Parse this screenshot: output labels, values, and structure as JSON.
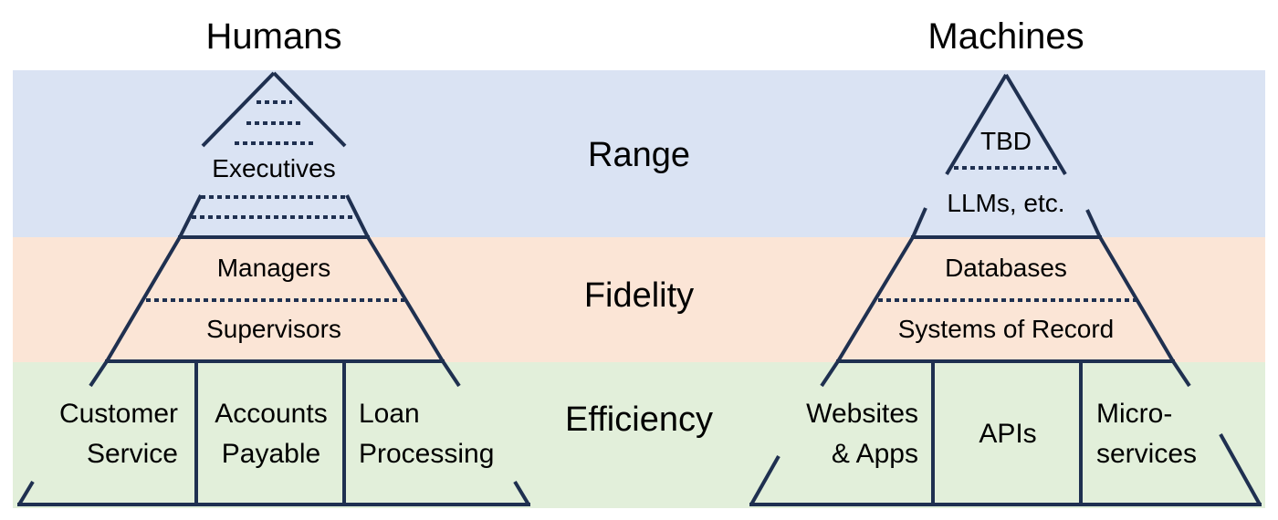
{
  "titles": {
    "left": "Humans",
    "right": "Machines"
  },
  "bands": [
    {
      "label": "Range",
      "color": "#dae3f3"
    },
    {
      "label": "Fidelity",
      "color": "#fbe5d6"
    },
    {
      "label": "Efficiency",
      "color": "#e2efda"
    }
  ],
  "line_color": "#1f3050",
  "humans": {
    "top_label": "Executives",
    "middle_labels": [
      "Managers",
      "Supervisors"
    ],
    "base_cells": [
      {
        "line1": "Customer",
        "line2": "Service"
      },
      {
        "line1": "Accounts",
        "line2": "Payable"
      },
      {
        "line1": "Loan",
        "line2": "Processing"
      }
    ]
  },
  "machines": {
    "apex_label": "TBD",
    "top_label": "LLMs, etc.",
    "middle_labels": [
      "Databases",
      "Systems of Record"
    ],
    "base_cells": [
      {
        "line1": "Websites",
        "line2": "& Apps"
      },
      {
        "line1": "APIs",
        "line2": ""
      },
      {
        "line1": "Micro-",
        "line2": "services"
      }
    ]
  }
}
